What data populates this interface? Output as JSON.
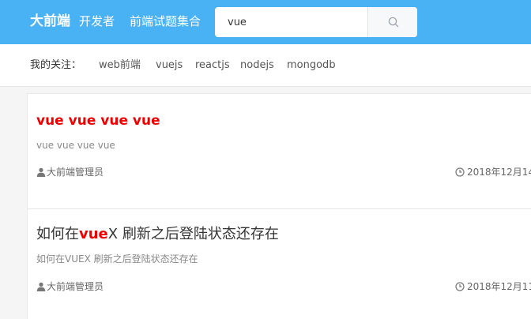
{
  "header": {
    "brand": "大前端",
    "nav": [
      "开发者",
      "前端试题集合"
    ],
    "search": {
      "value": "vue",
      "icon": "search-icon"
    }
  },
  "follow": {
    "label": "我的关注：",
    "tags": [
      "web前端",
      "vuejs",
      "reactjs",
      "nodejs",
      "mongodb"
    ]
  },
  "articles": [
    {
      "title_highlight": "vue vue vue vue",
      "title_rest": "",
      "title_prefix": "",
      "description": "vue vue vue vue",
      "author": "大前端管理员",
      "date": "2018年12月14",
      "author_icon": "user-icon",
      "date_icon": "clock-icon"
    },
    {
      "title_prefix": "如何在",
      "title_highlight": "vue",
      "title_rest": "X 刷新之后登陆状态还存在",
      "description": "如何在VUEX 刷新之后登陆状态还存在",
      "author": "大前端管理员",
      "date": "2018年12月11",
      "author_icon": "user-icon",
      "date_icon": "clock-icon"
    }
  ],
  "colors": {
    "header_bg": "#49b2f5",
    "highlight": "#ee0000"
  }
}
